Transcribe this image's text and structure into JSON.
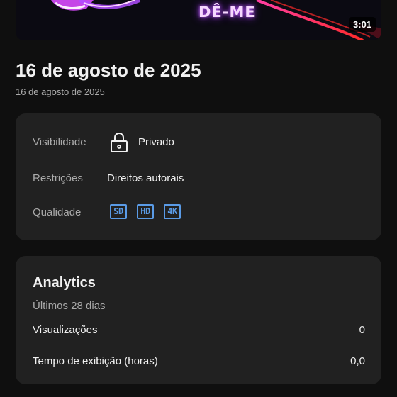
{
  "video": {
    "thumbnail_text": "DÊ-ME",
    "duration": "3:01",
    "title": "16 de agosto de 2025",
    "date": "16 de agosto de 2025"
  },
  "details": {
    "visibility_label": "Visibilidade",
    "visibility_value": "Privado",
    "visibility_icon": "lock-icon",
    "restrictions_label": "Restrições",
    "restrictions_value": "Direitos autorais",
    "quality_label": "Qualidade",
    "quality_badges": [
      "SD",
      "HD",
      "4K"
    ],
    "badge_color": "#5a9be6"
  },
  "analytics": {
    "title": "Analytics",
    "period": "Últimos 28 dias",
    "metrics": [
      {
        "label": "Visualizações",
        "value": "0"
      },
      {
        "label": "Tempo de exibição (horas)",
        "value": "0,0"
      }
    ]
  },
  "colors": {
    "background": "#0f0f0f",
    "card": "#212121",
    "text_primary": "#f1f1f1",
    "text_secondary": "#aaaaaa"
  }
}
